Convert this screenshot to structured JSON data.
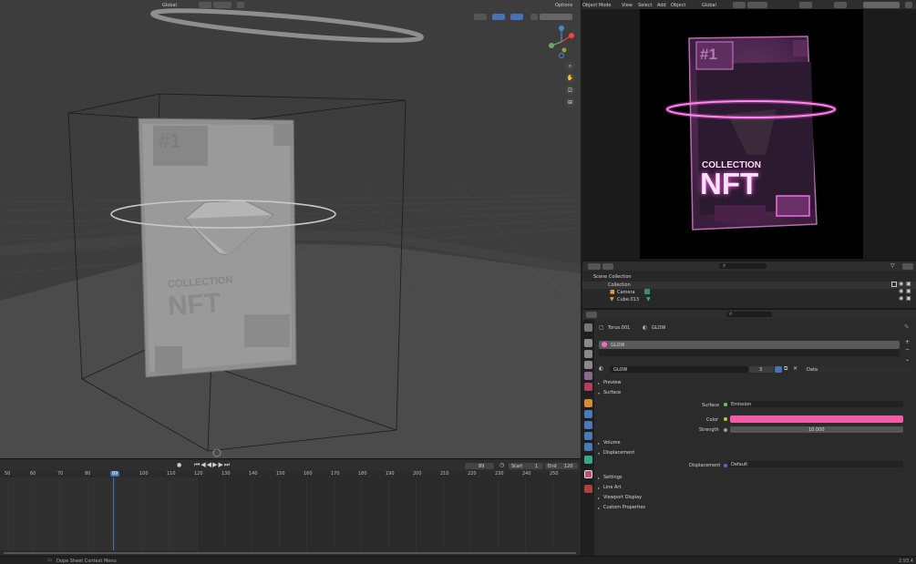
{
  "viewport": {
    "header": {
      "orientation": "Global",
      "options": "Options"
    },
    "card_emboss": {
      "number": "#1",
      "line1": "COLLECTION",
      "line2": "NFT"
    }
  },
  "editor_header": {
    "mode": "Object Mode",
    "menus": [
      "View",
      "Select",
      "Add",
      "Object"
    ],
    "orientation": "Global"
  },
  "render_preview": {
    "number": "#1",
    "line1": "COLLECTION",
    "line2": "NFT",
    "accent": "#e15bd7"
  },
  "outliner": {
    "root": "Scene Collection",
    "items": [
      {
        "label": "Collection"
      },
      {
        "label": "Camera"
      },
      {
        "label": "Cube.013"
      }
    ]
  },
  "properties": {
    "object_name": "Torus.001",
    "material_name": "GLOW",
    "slot_label": "GLOW",
    "datablock_name": "GLOW",
    "user_count": "3",
    "link": "Data",
    "sections": {
      "preview": "Preview",
      "surface": "Surface",
      "volume": "Volume",
      "displacement": "Displacement",
      "settings": "Settings",
      "line_art": "Line Art",
      "viewport_display": "Viewport Display",
      "custom_properties": "Custom Properties"
    },
    "surface_label": "Surface",
    "surface_value": "Emission",
    "color_label": "Color",
    "color_value": "#f05aa6",
    "strength_label": "Strength",
    "strength_value": "10.000",
    "displacement_label": "Displacement",
    "displacement_value": "Default"
  },
  "timeline": {
    "current_frame": "89",
    "start_label": "Start",
    "start_value": "1",
    "end_label": "End",
    "end_value": "120",
    "ticks": [
      "50",
      "60",
      "70",
      "80",
      "89",
      "100",
      "110",
      "120",
      "130",
      "140",
      "150",
      "160",
      "170",
      "180",
      "190",
      "200",
      "210",
      "220",
      "230",
      "240",
      "250"
    ]
  },
  "statusbar": {
    "hint": "Dope Sheet Context Menu",
    "version": "2.93.4"
  }
}
